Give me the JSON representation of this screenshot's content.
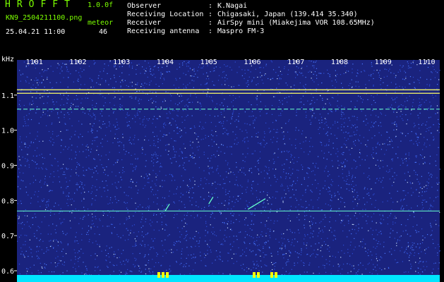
{
  "app": {
    "title": "HROFFT",
    "version": "1.0.0f"
  },
  "file": {
    "name": "KN9_2504211100.png",
    "datetime": "25.04.21 11:00"
  },
  "meteor": {
    "label": "meteor",
    "count": "46"
  },
  "station": [
    {
      "label": "Observer",
      "sep": ":",
      "value": "K.Nagai"
    },
    {
      "label": "Receiving Location",
      "sep": ":",
      "value": "Chigasaki, Japan (139.414 35.340)"
    },
    {
      "label": "Receiver",
      "sep": ":",
      "value": "AirSpy mini (Miakejima VOR 108.65MHz)"
    },
    {
      "label": "Receiving antenna",
      "sep": ":",
      "value": "Maspro FM-3"
    }
  ],
  "chart_data": {
    "type": "heatmap",
    "y_unit_label": "kHz",
    "yticks": [
      "1.1",
      "1.0",
      "0.9",
      "0.8",
      "0.7",
      "0.6"
    ],
    "ylim": [
      0.58,
      1.2
    ],
    "xticks": [
      "1101",
      "1102",
      "1103",
      "1104",
      "1105",
      "1106",
      "1107",
      "1108",
      "1109",
      "1110"
    ],
    "xlim": [
      1100.6,
      1110.3
    ],
    "grid": false,
    "colors": {
      "background": "#1a237e",
      "noise": "#4a78ff",
      "signal": "#ffff66",
      "trace": "#66ffcc",
      "baseline": "#00e5ff"
    },
    "continuous_signals_khz": [
      1.115,
      1.105,
      1.06,
      0.77
    ],
    "meteor_traces": [
      {
        "x": [
          1104.0,
          1104.1
        ],
        "y": [
          0.77,
          0.79
        ]
      },
      {
        "x": [
          1105.9,
          1106.3
        ],
        "y": [
          0.775,
          0.805
        ]
      },
      {
        "x": [
          1105.0,
          1105.1
        ],
        "y": [
          0.79,
          0.81
        ]
      }
    ]
  }
}
